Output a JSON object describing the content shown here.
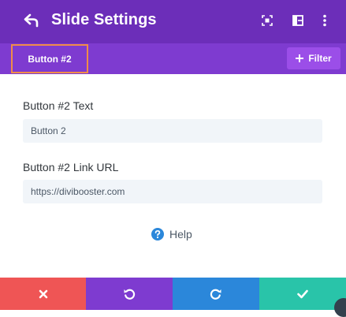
{
  "header": {
    "title": "Slide Settings",
    "icons": [
      "back-arrow-icon",
      "expand-icon",
      "sidebar-layout-icon",
      "more-vertical-icon"
    ],
    "bg": "#6c2eb9"
  },
  "subbar": {
    "tab_label": "Button #2",
    "filter_label": "Filter",
    "bg": "#7e3bd0",
    "tab_border_color": "#f08c48"
  },
  "fields": [
    {
      "label": "Button #2 Text",
      "value": "Button 2"
    },
    {
      "label": "Button #2 Link URL",
      "value": "https://divibooster.com"
    }
  ],
  "help": {
    "label": "Help"
  },
  "footer": {
    "buttons": [
      {
        "name": "discard",
        "icon": "close-icon",
        "color": "#ef5555"
      },
      {
        "name": "undo",
        "icon": "undo-icon",
        "color": "#7e3bd0"
      },
      {
        "name": "redo",
        "icon": "redo-icon",
        "color": "#2b87da"
      },
      {
        "name": "save",
        "icon": "check-icon",
        "color": "#29c4a9"
      }
    ]
  }
}
